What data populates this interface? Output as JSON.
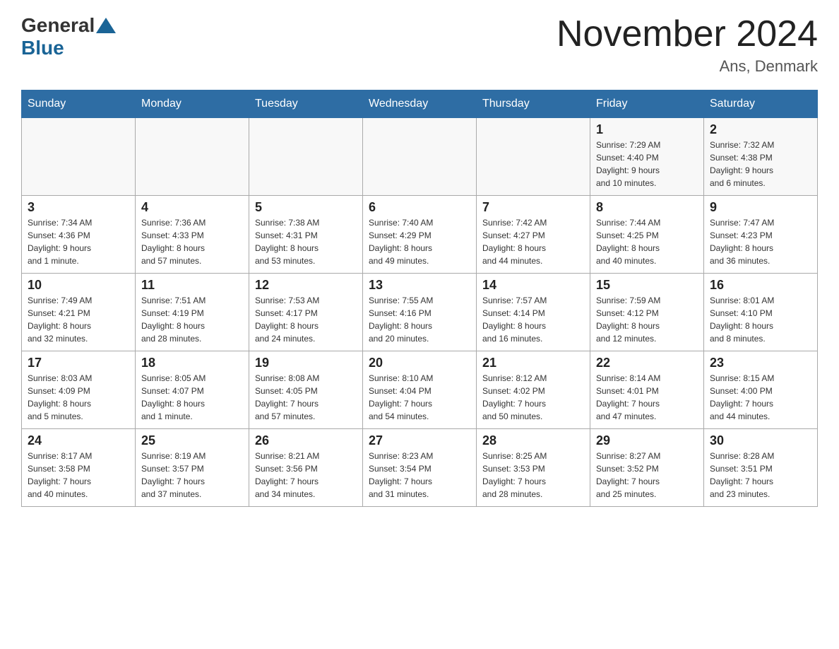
{
  "header": {
    "logo_text_general": "General",
    "logo_text_blue": "Blue",
    "title": "November 2024",
    "subtitle": "Ans, Denmark"
  },
  "days_of_week": [
    "Sunday",
    "Monday",
    "Tuesday",
    "Wednesday",
    "Thursday",
    "Friday",
    "Saturday"
  ],
  "weeks": [
    [
      {
        "day": "",
        "info": ""
      },
      {
        "day": "",
        "info": ""
      },
      {
        "day": "",
        "info": ""
      },
      {
        "day": "",
        "info": ""
      },
      {
        "day": "",
        "info": ""
      },
      {
        "day": "1",
        "info": "Sunrise: 7:29 AM\nSunset: 4:40 PM\nDaylight: 9 hours\nand 10 minutes."
      },
      {
        "day": "2",
        "info": "Sunrise: 7:32 AM\nSunset: 4:38 PM\nDaylight: 9 hours\nand 6 minutes."
      }
    ],
    [
      {
        "day": "3",
        "info": "Sunrise: 7:34 AM\nSunset: 4:36 PM\nDaylight: 9 hours\nand 1 minute."
      },
      {
        "day": "4",
        "info": "Sunrise: 7:36 AM\nSunset: 4:33 PM\nDaylight: 8 hours\nand 57 minutes."
      },
      {
        "day": "5",
        "info": "Sunrise: 7:38 AM\nSunset: 4:31 PM\nDaylight: 8 hours\nand 53 minutes."
      },
      {
        "day": "6",
        "info": "Sunrise: 7:40 AM\nSunset: 4:29 PM\nDaylight: 8 hours\nand 49 minutes."
      },
      {
        "day": "7",
        "info": "Sunrise: 7:42 AM\nSunset: 4:27 PM\nDaylight: 8 hours\nand 44 minutes."
      },
      {
        "day": "8",
        "info": "Sunrise: 7:44 AM\nSunset: 4:25 PM\nDaylight: 8 hours\nand 40 minutes."
      },
      {
        "day": "9",
        "info": "Sunrise: 7:47 AM\nSunset: 4:23 PM\nDaylight: 8 hours\nand 36 minutes."
      }
    ],
    [
      {
        "day": "10",
        "info": "Sunrise: 7:49 AM\nSunset: 4:21 PM\nDaylight: 8 hours\nand 32 minutes."
      },
      {
        "day": "11",
        "info": "Sunrise: 7:51 AM\nSunset: 4:19 PM\nDaylight: 8 hours\nand 28 minutes."
      },
      {
        "day": "12",
        "info": "Sunrise: 7:53 AM\nSunset: 4:17 PM\nDaylight: 8 hours\nand 24 minutes."
      },
      {
        "day": "13",
        "info": "Sunrise: 7:55 AM\nSunset: 4:16 PM\nDaylight: 8 hours\nand 20 minutes."
      },
      {
        "day": "14",
        "info": "Sunrise: 7:57 AM\nSunset: 4:14 PM\nDaylight: 8 hours\nand 16 minutes."
      },
      {
        "day": "15",
        "info": "Sunrise: 7:59 AM\nSunset: 4:12 PM\nDaylight: 8 hours\nand 12 minutes."
      },
      {
        "day": "16",
        "info": "Sunrise: 8:01 AM\nSunset: 4:10 PM\nDaylight: 8 hours\nand 8 minutes."
      }
    ],
    [
      {
        "day": "17",
        "info": "Sunrise: 8:03 AM\nSunset: 4:09 PM\nDaylight: 8 hours\nand 5 minutes."
      },
      {
        "day": "18",
        "info": "Sunrise: 8:05 AM\nSunset: 4:07 PM\nDaylight: 8 hours\nand 1 minute."
      },
      {
        "day": "19",
        "info": "Sunrise: 8:08 AM\nSunset: 4:05 PM\nDaylight: 7 hours\nand 57 minutes."
      },
      {
        "day": "20",
        "info": "Sunrise: 8:10 AM\nSunset: 4:04 PM\nDaylight: 7 hours\nand 54 minutes."
      },
      {
        "day": "21",
        "info": "Sunrise: 8:12 AM\nSunset: 4:02 PM\nDaylight: 7 hours\nand 50 minutes."
      },
      {
        "day": "22",
        "info": "Sunrise: 8:14 AM\nSunset: 4:01 PM\nDaylight: 7 hours\nand 47 minutes."
      },
      {
        "day": "23",
        "info": "Sunrise: 8:15 AM\nSunset: 4:00 PM\nDaylight: 7 hours\nand 44 minutes."
      }
    ],
    [
      {
        "day": "24",
        "info": "Sunrise: 8:17 AM\nSunset: 3:58 PM\nDaylight: 7 hours\nand 40 minutes."
      },
      {
        "day": "25",
        "info": "Sunrise: 8:19 AM\nSunset: 3:57 PM\nDaylight: 7 hours\nand 37 minutes."
      },
      {
        "day": "26",
        "info": "Sunrise: 8:21 AM\nSunset: 3:56 PM\nDaylight: 7 hours\nand 34 minutes."
      },
      {
        "day": "27",
        "info": "Sunrise: 8:23 AM\nSunset: 3:54 PM\nDaylight: 7 hours\nand 31 minutes."
      },
      {
        "day": "28",
        "info": "Sunrise: 8:25 AM\nSunset: 3:53 PM\nDaylight: 7 hours\nand 28 minutes."
      },
      {
        "day": "29",
        "info": "Sunrise: 8:27 AM\nSunset: 3:52 PM\nDaylight: 7 hours\nand 25 minutes."
      },
      {
        "day": "30",
        "info": "Sunrise: 8:28 AM\nSunset: 3:51 PM\nDaylight: 7 hours\nand 23 minutes."
      }
    ]
  ]
}
